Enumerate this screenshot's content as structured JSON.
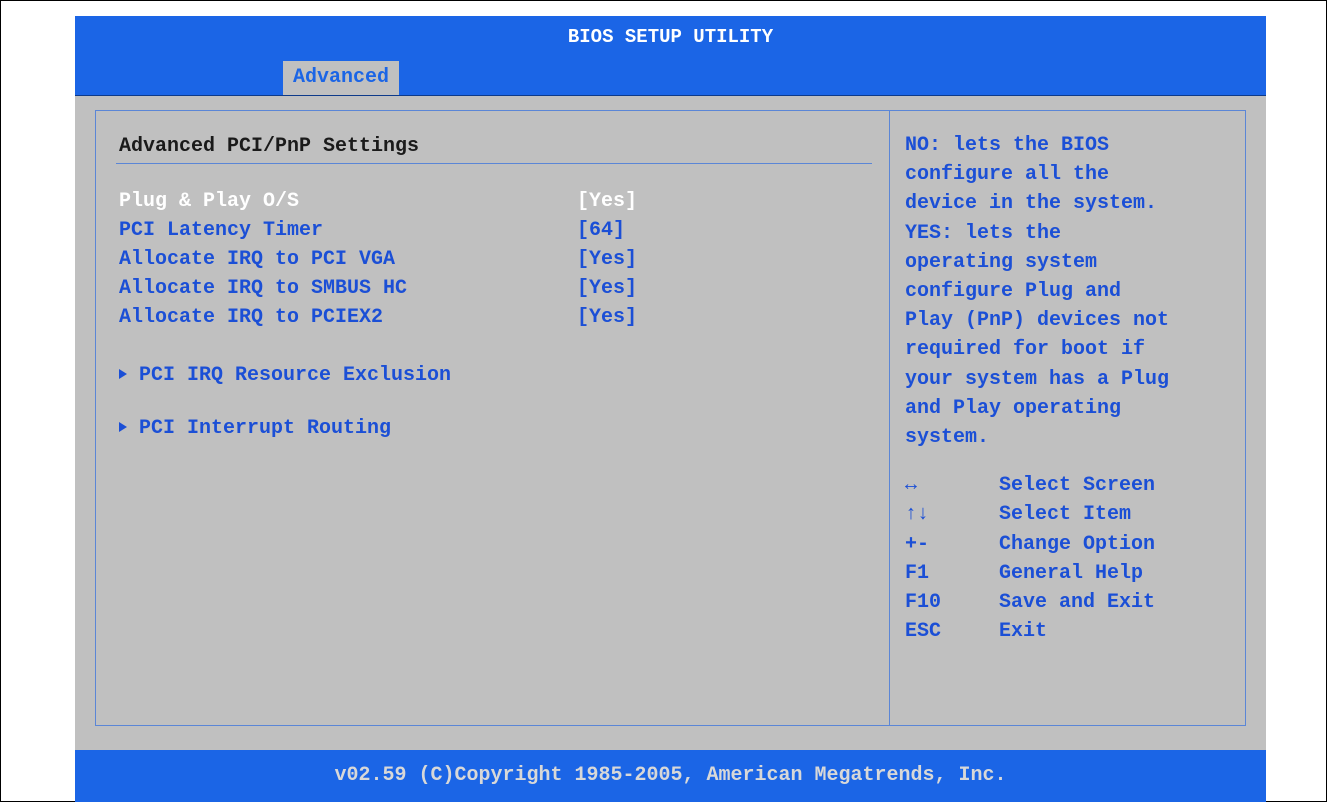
{
  "window": {
    "title": "BIOS SETUP UTILITY"
  },
  "tabs": [
    {
      "label": "Advanced",
      "active": true
    }
  ],
  "main": {
    "section_title": "Advanced PCI/PnP Settings",
    "settings": [
      {
        "label": "Plug & Play O/S",
        "value": "[Yes]",
        "selected": true
      },
      {
        "label": "PCI Latency Timer",
        "value": "[64]"
      },
      {
        "label": "Allocate IRQ to PCI VGA",
        "value": "[Yes]"
      },
      {
        "label": "Allocate IRQ to SMBUS HC",
        "value": "[Yes]"
      },
      {
        "label": "Allocate IRQ to PCIEX2",
        "value": "[Yes]"
      }
    ],
    "submenus": [
      {
        "label": "PCI IRQ Resource Exclusion",
        "icon": "triangle-right-icon"
      },
      {
        "label": "PCI Interrupt Routing",
        "icon": "triangle-right-icon"
      }
    ]
  },
  "help": {
    "lines": [
      "NO: lets the BIOS",
      "configure all the",
      "device in the system.",
      "YES: lets the",
      "operating system",
      "configure Plug and",
      "Play (PnP) devices not",
      "required for boot if",
      "your system has a Plug",
      "and Play operating",
      "system."
    ],
    "keys": [
      {
        "key": "↔",
        "desc": "Select Screen"
      },
      {
        "key": "↑↓",
        "desc": "Select Item"
      },
      {
        "key": "+-",
        "desc": "Change Option"
      },
      {
        "key": "F1",
        "desc": "General Help"
      },
      {
        "key": "F10",
        "desc": "Save and Exit"
      },
      {
        "key": "ESC",
        "desc": "Exit"
      }
    ]
  },
  "footer": {
    "text": "v02.59 (C)Copyright 1985-2005, American Megatrends, Inc."
  },
  "colors": {
    "bar_blue": "#1b65e6",
    "panel_gray": "#c0c0c0",
    "text_blue": "#1b4fd6",
    "selected_text": "#ffffff"
  }
}
